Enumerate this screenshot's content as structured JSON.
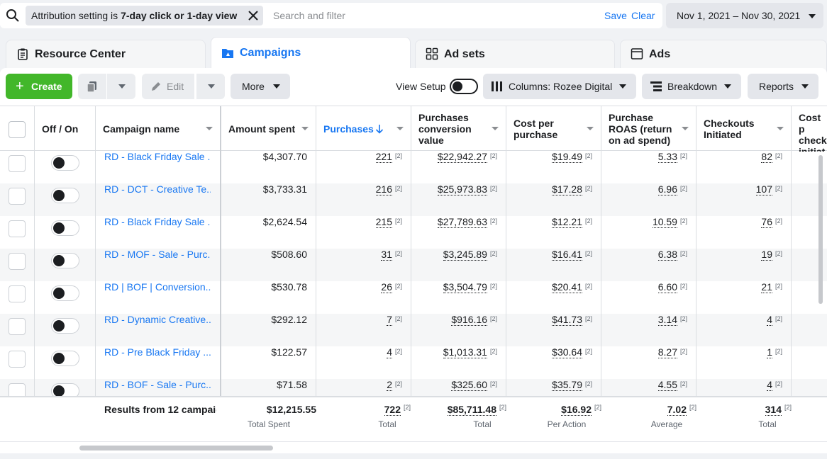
{
  "filter": {
    "chip_prefix": "Attribution setting is ",
    "chip_bold": "7-day click or 1-day view",
    "search_placeholder": "Search and filter",
    "save_label": "Save",
    "clear_label": "Clear"
  },
  "date_range": "Nov 1, 2021 – Nov 30, 2021",
  "tabs": [
    {
      "label": "Resource Center",
      "icon": "clipboard-icon"
    },
    {
      "label": "Campaigns",
      "icon": "folder-flag-icon",
      "active": true
    },
    {
      "label": "Ad sets",
      "icon": "grid-icon"
    },
    {
      "label": "Ads",
      "icon": "ad-frame-icon"
    }
  ],
  "toolbar": {
    "create_label": "Create",
    "edit_label": "Edit",
    "more_label": "More",
    "view_setup_label": "View Setup",
    "columns_label": "Columns: Rozee Digital",
    "breakdown_label": "Breakdown",
    "reports_label": "Reports"
  },
  "columns": {
    "off_on": "Off / On",
    "campaign_name": "Campaign name",
    "amount_spent": "Amount spent",
    "purchases": "Purchases",
    "purchases_value_1": "Purchases",
    "purchases_value_2": "conversion",
    "purchases_value_3": "value",
    "cost_per_1": "Cost per",
    "cost_per_2": "purchase",
    "roas_1": "Purchase",
    "roas_2": "ROAS (return",
    "roas_3": "on ad spend)",
    "checkouts_1": "Checkouts",
    "checkouts_2": "Initiated",
    "cost_check_1": "Cost p",
    "cost_check_2": "check",
    "cost_check_3": "initiat"
  },
  "footnote_marker": "[2]",
  "rows": [
    {
      "name": "RD - Black Friday Sale ...",
      "spent": "$4,307.70",
      "purchases": "221",
      "value": "$22,942.27",
      "cpp": "$19.49",
      "roas": "5.33",
      "checkouts": "82"
    },
    {
      "name": "RD - DCT - Creative Te...",
      "spent": "$3,733.31",
      "purchases": "216",
      "value": "$25,973.83",
      "cpp": "$17.28",
      "roas": "6.96",
      "checkouts": "107"
    },
    {
      "name": "RD - Black Friday Sale ...",
      "spent": "$2,624.54",
      "purchases": "215",
      "value": "$27,789.63",
      "cpp": "$12.21",
      "roas": "10.59",
      "checkouts": "76"
    },
    {
      "name": "RD - MOF - Sale - Purc...",
      "spent": "$508.60",
      "purchases": "31",
      "value": "$3,245.89",
      "cpp": "$16.41",
      "roas": "6.38",
      "checkouts": "19"
    },
    {
      "name": "RD | BOF | Conversion...",
      "spent": "$530.78",
      "purchases": "26",
      "value": "$3,504.79",
      "cpp": "$20.41",
      "roas": "6.60",
      "checkouts": "21"
    },
    {
      "name": "RD - Dynamic Creative...",
      "spent": "$292.12",
      "purchases": "7",
      "value": "$916.16",
      "cpp": "$41.73",
      "roas": "3.14",
      "checkouts": "4"
    },
    {
      "name": "RD - Pre Black Friday ...",
      "spent": "$122.57",
      "purchases": "4",
      "value": "$1,013.31",
      "cpp": "$30.64",
      "roas": "8.27",
      "checkouts": "1"
    },
    {
      "name": "RD - BOF - Sale - Purc...",
      "spent": "$71.58",
      "purchases": "2",
      "value": "$325.60",
      "cpp": "$35.79",
      "roas": "4.55",
      "checkouts": "4"
    }
  ],
  "totals": {
    "name": "Results from 12 campaig",
    "spent": "$12,215.55",
    "spent_sub": "Total Spent",
    "purchases": "722",
    "purchases_sub": "Total",
    "value": "$85,711.48",
    "value_sub": "Total",
    "cpp": "$16.92",
    "cpp_sub": "Per Action",
    "roas": "7.02",
    "roas_sub": "Average",
    "checkouts": "314",
    "checkouts_sub": "Total"
  },
  "colors": {
    "accent": "#1877f2",
    "create": "#42b72a"
  }
}
